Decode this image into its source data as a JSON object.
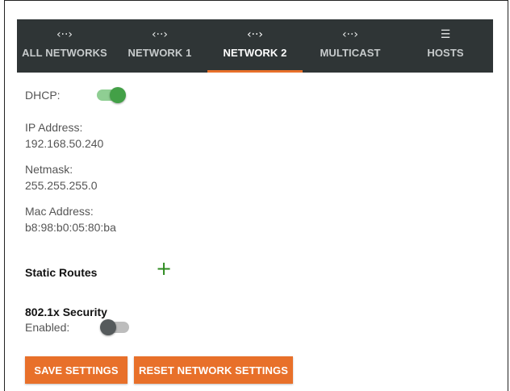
{
  "tabs": [
    {
      "icon": "‹··›",
      "label": "ALL NETWORKS"
    },
    {
      "icon": "‹··›",
      "label": "NETWORK 1"
    },
    {
      "icon": "‹··›",
      "label": "NETWORK 2"
    },
    {
      "icon": "‹··›",
      "label": "MULTICAST"
    },
    {
      "icon": "☰",
      "label": "HOSTS"
    }
  ],
  "active_tab": "NETWORK 2",
  "dhcp": {
    "label": "DHCP:",
    "enabled": true
  },
  "ip": {
    "label": "IP Address:",
    "value": "192.168.50.240"
  },
  "netmask": {
    "label": "Netmask:",
    "value": "255.255.255.0"
  },
  "mac": {
    "label": "Mac Address:",
    "value": "b8:98:b0:05:80:ba"
  },
  "static_routes": {
    "title": "Static Routes",
    "add_icon": "+"
  },
  "security": {
    "title": "802.1x Security",
    "enabled_label": "Enabled:",
    "enabled": false
  },
  "buttons": {
    "save": "SAVE SETTINGS",
    "reset": "RESET NETWORK SETTINGS"
  },
  "colors": {
    "accent": "#e8702a",
    "tabbar": "#2f3536",
    "toggle_on": "#43a047",
    "add_icon": "#2e8b1f"
  }
}
